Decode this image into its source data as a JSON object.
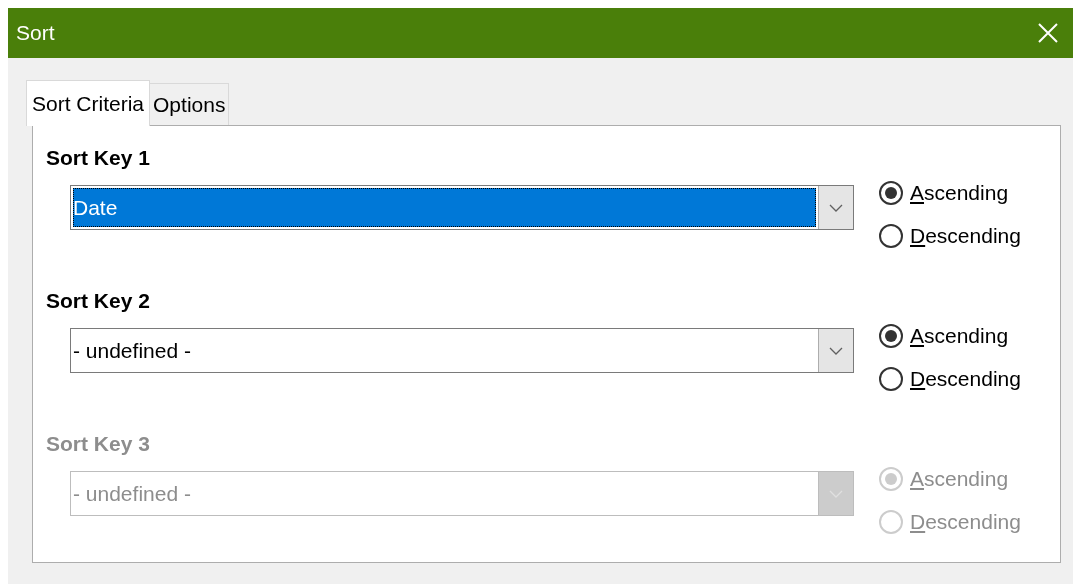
{
  "window": {
    "title": "Sort"
  },
  "tabs": [
    {
      "label": "Sort Criteria",
      "selected": true
    },
    {
      "label": "Options",
      "selected": false
    }
  ],
  "sort_keys": [
    {
      "label": "Sort Key 1",
      "disabled": false,
      "value": "Date",
      "focused": true,
      "options": [
        {
          "label": "Ascending",
          "selected": true,
          "underline_first": true
        },
        {
          "label": "Descending",
          "selected": false,
          "underline_first": true
        }
      ]
    },
    {
      "label": "Sort Key 2",
      "disabled": false,
      "value": "- undefined -",
      "focused": false,
      "options": [
        {
          "label": "Ascending",
          "selected": true,
          "underline_first": true
        },
        {
          "label": "Descending",
          "selected": false,
          "underline_first": true
        }
      ]
    },
    {
      "label": "Sort Key 3",
      "disabled": true,
      "value": "- undefined -",
      "focused": false,
      "options": [
        {
          "label": "Ascending",
          "selected": true,
          "underline_first": true
        },
        {
          "label": "Descending",
          "selected": false,
          "underline_first": true
        }
      ]
    }
  ]
}
